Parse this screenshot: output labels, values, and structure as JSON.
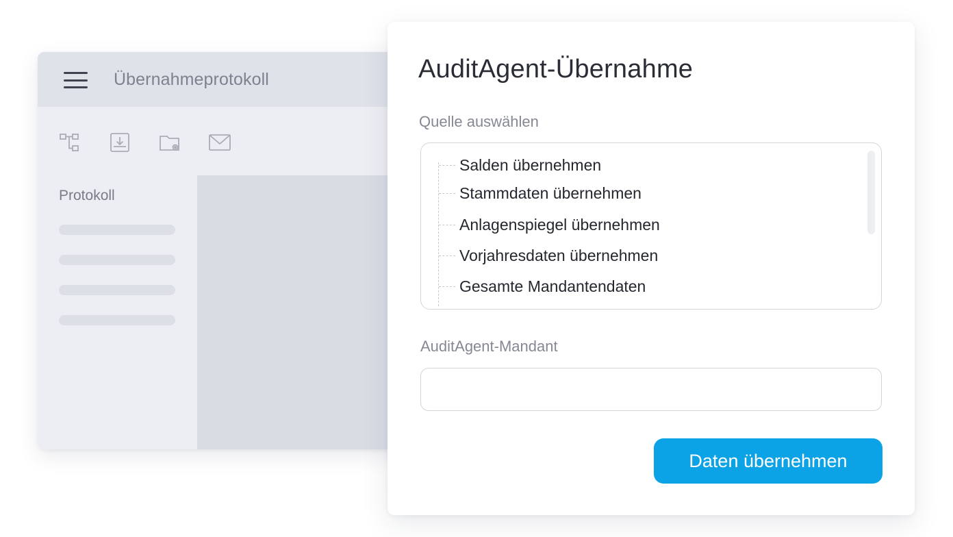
{
  "background_window": {
    "title": "Übernahmeprotokoll",
    "toolbar_icons": [
      "hierarchy-icon",
      "download-tray-icon",
      "folder-settings-icon",
      "mail-icon"
    ],
    "sidebar": {
      "title": "Protokoll"
    }
  },
  "dialog": {
    "title": "AuditAgent-Übernahme",
    "source_label": "Quelle auswählen",
    "source_items": [
      "Salden übernehmen",
      "Stammdaten übernehmen",
      "Anlagenspiegel übernehmen",
      "Vorjahresdaten übernehmen",
      "Gesamte Mandantendaten"
    ],
    "client_label": "AuditAgent-Mandant",
    "client_value": "",
    "client_placeholder": "",
    "submit_label": "Daten übernehmen"
  },
  "colors": {
    "accent": "#0ba2e6",
    "header_bg": "#dfe2e9",
    "window_bg": "#eceef3"
  }
}
